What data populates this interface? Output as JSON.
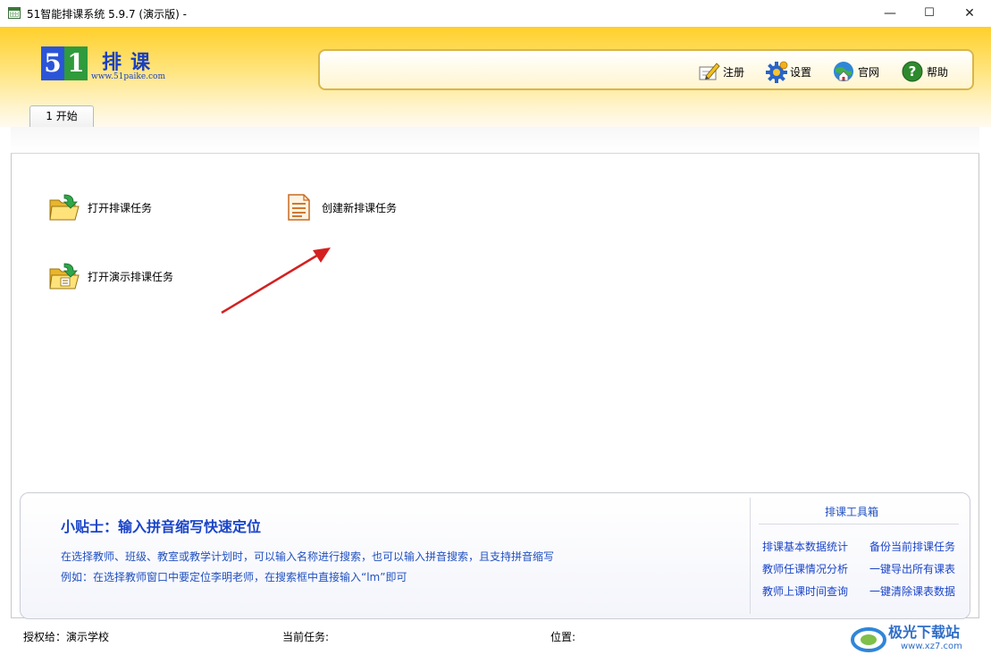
{
  "window": {
    "title": "51智能排课系统 5.9.7 (演示版) -",
    "controls": {
      "minimize": "—",
      "maximize": "☐",
      "close": "✕"
    }
  },
  "logo": {
    "digit1": "5",
    "digit2": "1",
    "text": "排课",
    "url": "www.51paike.com"
  },
  "toolbar": {
    "items": [
      {
        "label": "注册",
        "icon": "register-pen-icon"
      },
      {
        "label": "设置",
        "icon": "gear-icon"
      },
      {
        "label": "官网",
        "icon": "globe-home-icon"
      },
      {
        "label": "帮助",
        "icon": "help-icon"
      }
    ]
  },
  "tabs": [
    {
      "label": "1 开始"
    }
  ],
  "actions": {
    "open_task": "打开排课任务",
    "new_task": "创建新排课任务",
    "open_demo": "打开演示排课任务"
  },
  "tips": {
    "title": "小贴士：输入拼音缩写快速定位",
    "line1": "在选择教师、班级、教室或教学计划时，可以输入名称进行搜索，也可以输入拼音搜索，且支持拼音缩写",
    "line2": "例如：在选择教师窗口中要定位李明老师，在搜索框中直接输入“lm”即可"
  },
  "toolbox": {
    "title": "排课工具箱",
    "links": {
      "stats": "排课基本数据统计",
      "backup": "备份当前排课任务",
      "teacher_load": "教师任课情况分析",
      "export_all": "一键导出所有课表",
      "teacher_time": "教师上课时间查询",
      "clear_all": "一键清除课表数据"
    }
  },
  "status": {
    "licensed_label": "授权给：演示学校",
    "current_task_label": "当前任务:",
    "position_label": "位置:"
  },
  "watermark": {
    "brand": "极光下载站",
    "url": "www.xz7.com"
  },
  "colors": {
    "accent": "#1a44c8",
    "header_gold": "#ffcf2a",
    "arrow": "#d42020"
  }
}
